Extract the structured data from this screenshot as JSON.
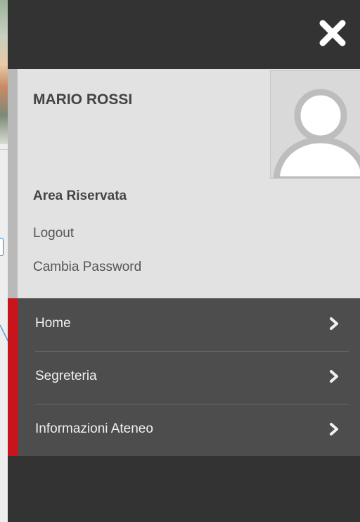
{
  "colors": {
    "header_bg": "#333333",
    "profile_bg": "#e2e2e2",
    "menu_bg": "#4d4d4d",
    "accent_red": "#c8151b",
    "annotation_arrow": "#5b9bd5"
  },
  "header": {
    "close_icon": "close-x-icon"
  },
  "profile": {
    "name": "MARIO ROSSI",
    "avatar_icon": "user-placeholder-icon",
    "area_title": "Area Riservata",
    "links": {
      "logout": "Logout",
      "change_password": "Cambia Password"
    }
  },
  "menu": {
    "items": [
      {
        "label": "Home",
        "icon": "chevron-right-icon"
      },
      {
        "label": "Segreteria",
        "icon": "chevron-right-icon"
      },
      {
        "label": "Informazioni Ateneo",
        "icon": "chevron-right-icon"
      }
    ]
  }
}
